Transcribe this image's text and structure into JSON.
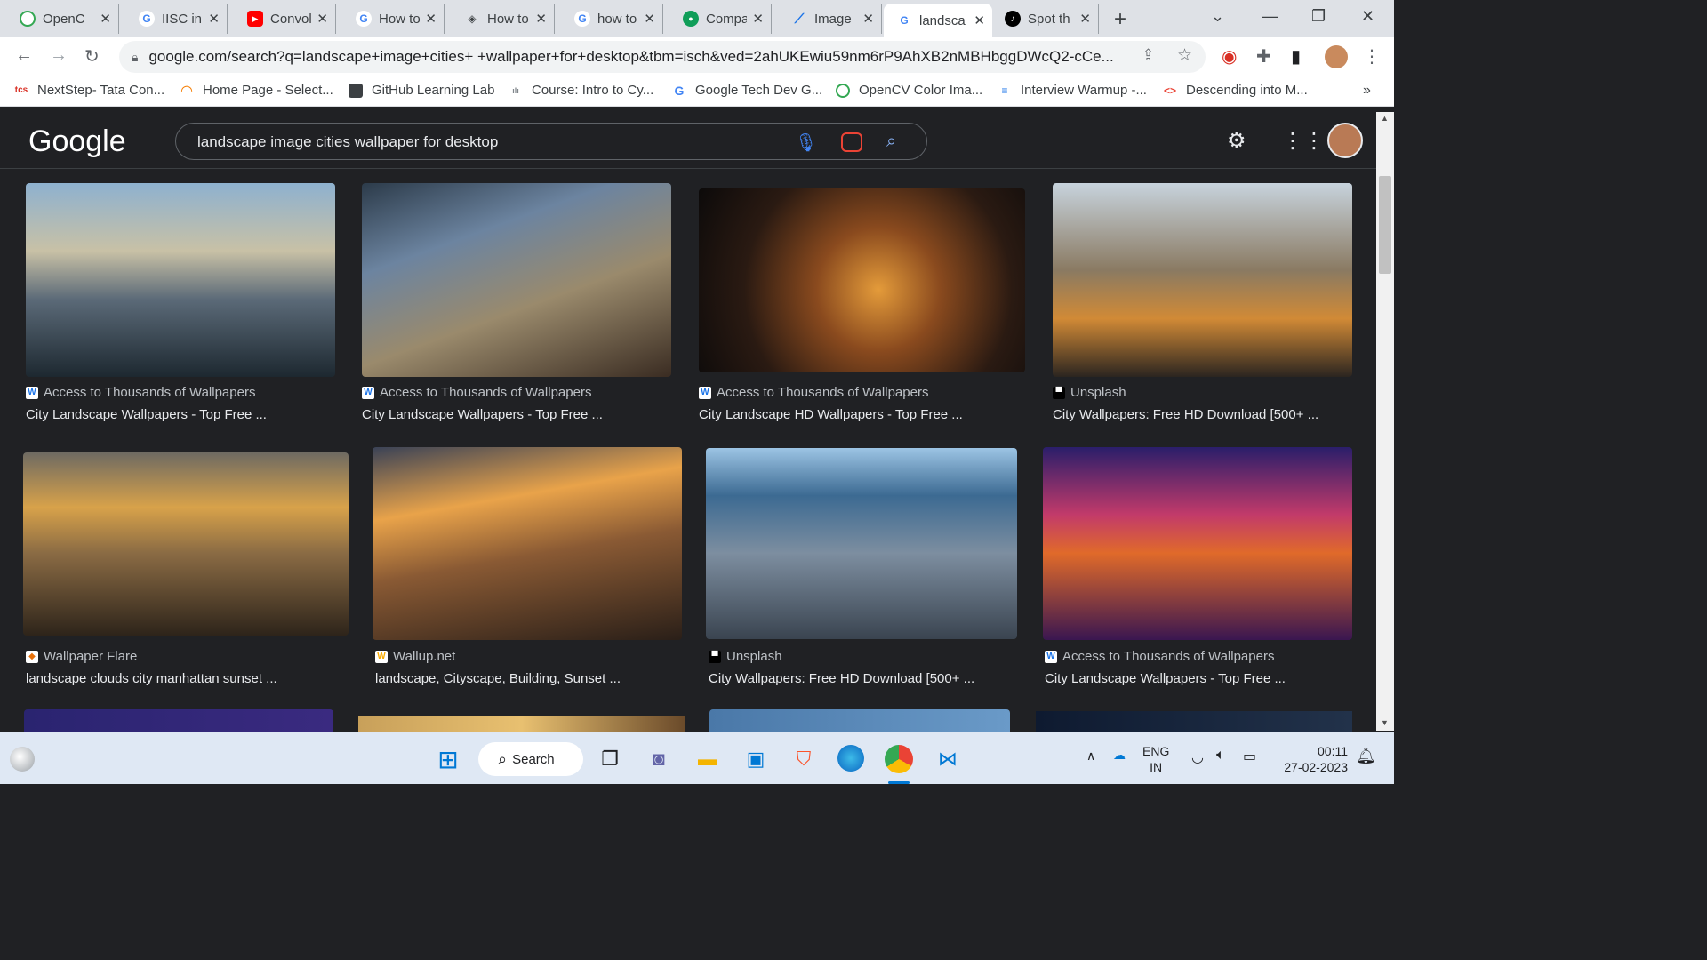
{
  "tabs": [
    {
      "title": "OpenC",
      "icon": "opencv-icon"
    },
    {
      "title": "IISC in",
      "icon": "google-icon"
    },
    {
      "title": "Convol",
      "icon": "youtube-icon"
    },
    {
      "title": "How to",
      "icon": "google-icon"
    },
    {
      "title": "How to",
      "icon": "site-icon"
    },
    {
      "title": "how to",
      "icon": "google-icon"
    },
    {
      "title": "Compa",
      "icon": "site-icon"
    },
    {
      "title": "Image",
      "icon": "chart-icon"
    },
    {
      "title": "landsca",
      "icon": "google-icon"
    },
    {
      "title": "Spot th",
      "icon": "site-icon"
    }
  ],
  "address_bar": {
    "url": "google.com/search?q=landscape+image+cities+ +wallpaper+for+desktop&tbm=isch&ved=2ahUKEwiu59nm6rP9AhXB2nMBHbggDWcQ2-cCe..."
  },
  "bookmarks": [
    {
      "label": "NextStep- Tata Con...",
      "icon": "tcs"
    },
    {
      "label": "Home Page - Select...",
      "icon": "c"
    },
    {
      "label": "GitHub Learning Lab",
      "icon": "gh"
    },
    {
      "label": "Course: Intro to Cy...",
      "icon": "cs"
    },
    {
      "label": "Google Tech Dev G...",
      "icon": "G"
    },
    {
      "label": "OpenCV Color Ima...",
      "icon": "o"
    },
    {
      "label": "Interview Warmup -...",
      "icon": "iw"
    },
    {
      "label": "Descending into M...",
      "icon": "<>"
    }
  ],
  "google": {
    "logo": "Google",
    "query": "landscape image cities  wallpaper for desktop"
  },
  "results": [
    {
      "source": "Access to Thousands of Wallpapers",
      "title": "City Landscape Wallpapers - Top Free ...",
      "icon": "W"
    },
    {
      "source": "Access to Thousands of Wallpapers",
      "title": "City Landscape Wallpapers - Top Free ...",
      "icon": "W"
    },
    {
      "source": "Access to Thousands of Wallpapers",
      "title": "City Landscape HD Wallpapers - Top Free ...",
      "icon": "W"
    },
    {
      "source": "Unsplash",
      "title": "City Wallpapers: Free HD Download [500+ ...",
      "icon": "U"
    },
    {
      "source": "Wallpaper Flare",
      "title": "landscape clouds city manhattan sunset ...",
      "icon": "F"
    },
    {
      "source": "Wallup.net",
      "title": "landscape, Cityscape, Building, Sunset ...",
      "icon": "W"
    },
    {
      "source": "Unsplash",
      "title": "City Wallpapers: Free HD Download [500+ ...",
      "icon": "U"
    },
    {
      "source": "Access to Thousands of Wallpapers",
      "title": "City Landscape Wallpapers - Top Free ...",
      "icon": "W"
    }
  ],
  "taskbar": {
    "search_label": "Search",
    "lang1": "ENG",
    "lang2": "IN",
    "time": "00:11",
    "date": "27-02-2023"
  }
}
